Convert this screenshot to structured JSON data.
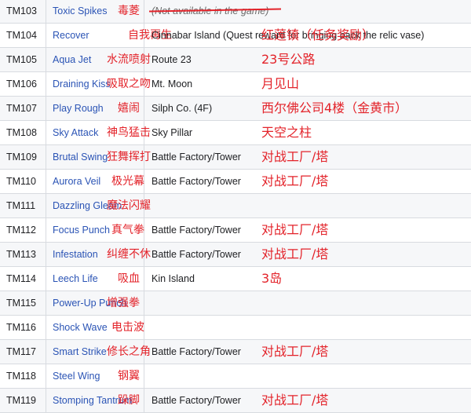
{
  "rows": [
    {
      "num": "TM103",
      "move": "Toxic Spikes",
      "move_cn": "毒菱",
      "location": "(Not available in the game)",
      "location_cn": ""
    },
    {
      "num": "TM104",
      "move": "Recover",
      "move_cn": "自我再生",
      "location": "Cinnabar Island (Quest reward for bringing back the relic vase)",
      "location_cn": "红莲镇（任务奖励）"
    },
    {
      "num": "TM105",
      "move": "Aqua Jet",
      "move_cn": "水流喷射",
      "location": "Route 23",
      "location_cn": "23号公路"
    },
    {
      "num": "TM106",
      "move": "Draining Kiss",
      "move_cn": "吸取之吻",
      "location": "Mt. Moon",
      "location_cn": "月见山"
    },
    {
      "num": "TM107",
      "move": "Play Rough",
      "move_cn": "嬉闹",
      "location": "Silph Co. (4F)",
      "location_cn": "西尔佛公司4楼（金黄市）"
    },
    {
      "num": "TM108",
      "move": "Sky Attack",
      "move_cn": "神鸟猛击",
      "location": "Sky Pillar",
      "location_cn": "天空之柱"
    },
    {
      "num": "TM109",
      "move": "Brutal Swing",
      "move_cn": "狂舞挥打",
      "location": "Battle Factory/Tower",
      "location_cn": "对战工厂/塔"
    },
    {
      "num": "TM110",
      "move": "Aurora Veil",
      "move_cn": "极光幕",
      "location": "Battle Factory/Tower",
      "location_cn": "对战工厂/塔"
    },
    {
      "num": "TM111",
      "move": "Dazzling Gleam",
      "move_cn": "魔法闪耀",
      "location": "",
      "location_cn": ""
    },
    {
      "num": "TM112",
      "move": "Focus Punch",
      "move_cn": "真气拳",
      "location": "Battle Factory/Tower",
      "location_cn": "对战工厂/塔"
    },
    {
      "num": "TM113",
      "move": "Infestation",
      "move_cn": "纠缠不休",
      "location": "Battle Factory/Tower",
      "location_cn": "对战工厂/塔"
    },
    {
      "num": "TM114",
      "move": "Leech Life",
      "move_cn": "吸血",
      "location": "Kin Island",
      "location_cn": "3岛"
    },
    {
      "num": "TM115",
      "move": "Power-Up Punch",
      "move_cn": "增强拳",
      "location": "",
      "location_cn": ""
    },
    {
      "num": "TM116",
      "move": "Shock Wave",
      "move_cn": "电击波",
      "location": "",
      "location_cn": ""
    },
    {
      "num": "TM117",
      "move": "Smart Strike",
      "move_cn": "修长之角",
      "location": "Battle Factory/Tower",
      "location_cn": "对战工厂/塔"
    },
    {
      "num": "TM118",
      "move": "Steel Wing",
      "move_cn": "钢翼",
      "location": "",
      "location_cn": ""
    },
    {
      "num": "TM119",
      "move": "Stomping Tantrum",
      "move_cn": "跺脚",
      "location": "Battle Factory/Tower",
      "location_cn": "对战工厂/塔"
    }
  ],
  "colors": {
    "link": "#2b54b5",
    "annotation": "#e3232a",
    "border": "#d8dbe0",
    "row_alt": "#f6f7f9"
  }
}
